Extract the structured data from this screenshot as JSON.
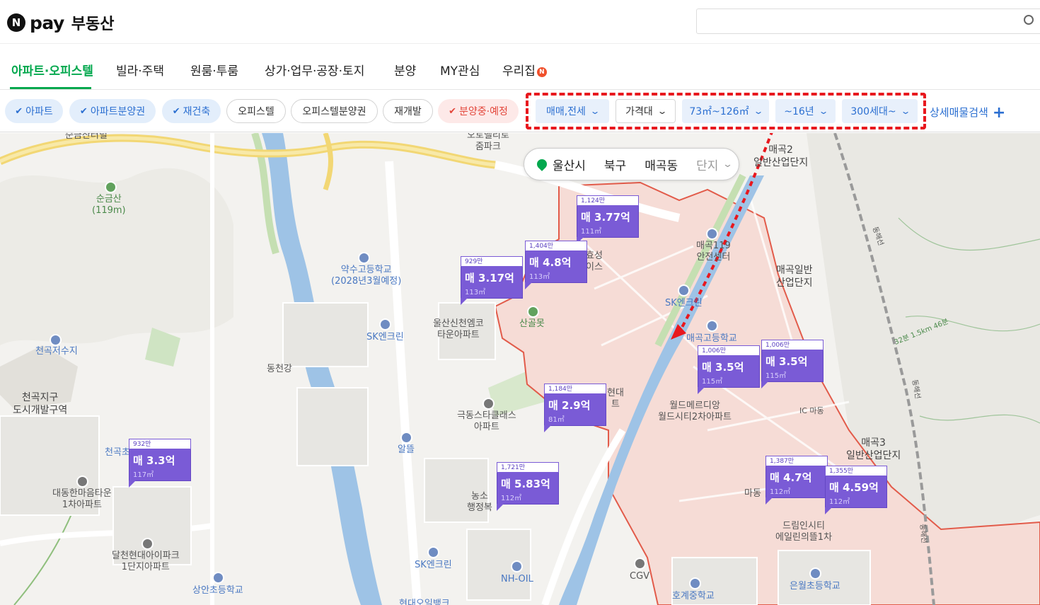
{
  "header": {
    "logo_n": "N",
    "logo_pay": "pay",
    "logo_service": "부동산"
  },
  "tabs": [
    {
      "label": "아파트·오피스텔",
      "active": true
    },
    {
      "label": "빌라·주택"
    },
    {
      "label": "원룸·투룸"
    },
    {
      "label": "상가·업무·공장·토지"
    },
    {
      "label": "분양"
    },
    {
      "label": "MY관심"
    },
    {
      "label": "우리집",
      "badge": "N"
    }
  ],
  "filters": {
    "chips": [
      {
        "label": "아파트",
        "selected": true
      },
      {
        "label": "아파트분양권",
        "selected": true
      },
      {
        "label": "재건축",
        "selected": true
      },
      {
        "label": "오피스텔",
        "selected": false
      },
      {
        "label": "오피스텔분양권",
        "selected": false
      },
      {
        "label": "재개발",
        "selected": false
      },
      {
        "label": "분양중·예정",
        "selected": true
      }
    ],
    "dropdowns": [
      {
        "label": "매매,전세"
      },
      {
        "label": "가격대"
      },
      {
        "label": "73㎡~126㎡"
      },
      {
        "label": "~16년"
      },
      {
        "label": "300세대~"
      }
    ],
    "detail_search": "상세매물검색",
    "detail_plus": "+"
  },
  "location": {
    "city": "울산시",
    "district": "북구",
    "dong": "매곡동",
    "complex": "단지"
  },
  "markers": [
    {
      "count": "1,124만",
      "price": "매 3.77억",
      "area": "111㎡"
    },
    {
      "count": "1,404만",
      "price": "매 4.8억",
      "area": "113㎡"
    },
    {
      "count": "929만",
      "price": "매 3.17억",
      "area": "113㎡"
    },
    {
      "count": "1,006만",
      "price": "매 3.5억",
      "area": "115㎡"
    },
    {
      "count": "1,006만",
      "price": "매 3.5억",
      "area": "115㎡"
    },
    {
      "count": "1,184만",
      "price": "매 2.9억",
      "area": "81㎡"
    },
    {
      "count": "932만",
      "price": "매 3.3억",
      "area": "117㎡"
    },
    {
      "count": "1,721만",
      "price": "매 5.83억",
      "area": "112㎡"
    },
    {
      "count": "1,387만",
      "price": "매 4.7억",
      "area": "112㎡"
    },
    {
      "count": "1,355만",
      "price": "매 4.59억",
      "area": "112㎡"
    }
  ],
  "map_labels": {
    "mountain": "순금산\n(119m)",
    "sunggeum": "순금산터널",
    "otovalley": "오토밸리로\n줌파크",
    "maegok2": "매곡2\n일반산업단지",
    "yaksu": "약수고등학교\n(2028년3월예정)",
    "ulsan_sincheon": "울산신천엠코\n타운아파트",
    "sangolmot": "산골못",
    "sk_energy1": "SK엔크린",
    "sk_energy2": "SK엔크린",
    "sk_energy3": "SK엔크린",
    "maegok119": "매곡119\n안전센터",
    "maegok_ind": "매곡일반\n산업단지",
    "maegok_high": "매곡고등학교",
    "hyosung": "효성\n이스",
    "cheongok_res": "천곡저수지",
    "dongcheon": "동천강",
    "cheongok_dist": "천곡지구\n도시개발구역",
    "cheongok": "천곡초",
    "daedong": "대동한마음타운\n1차아파트",
    "geukdong": "극동스타클래스\n아파트",
    "altteul": "알뜰",
    "world_meridian": "월드메르디앙\n월드시티2차아파트",
    "maedong_ic": "IC 마동",
    "maegok3": "매곡3\n일반산업단지",
    "hyundai": "현대\n트",
    "nongso": "농소\n행정복",
    "maedong": "마동",
    "dreamincity": "드림인시티\n에일린의뜰1차",
    "dalcheon": "달천현대아이파크\n1단지아파트",
    "sk_energy4": "SK엔크린",
    "nhoil": "NH-OIL",
    "cgv": "CGV",
    "hogye": "호계중학교",
    "eunwol": "은월초등학교",
    "sangan": "상안초등학교",
    "hyundai_oil": "현대오일뱅크",
    "rail1": "동해선",
    "rail2": "동해선",
    "rail3": "동해선",
    "distance": "32분 1.5km 46분"
  },
  "colors": {
    "naver_green": "#03a84e",
    "filter_blue": "#2b6fd1",
    "marker_purple": "#7a5bd6",
    "highlight_red": "#e8181e",
    "area_fill": "#f6dcd6"
  }
}
